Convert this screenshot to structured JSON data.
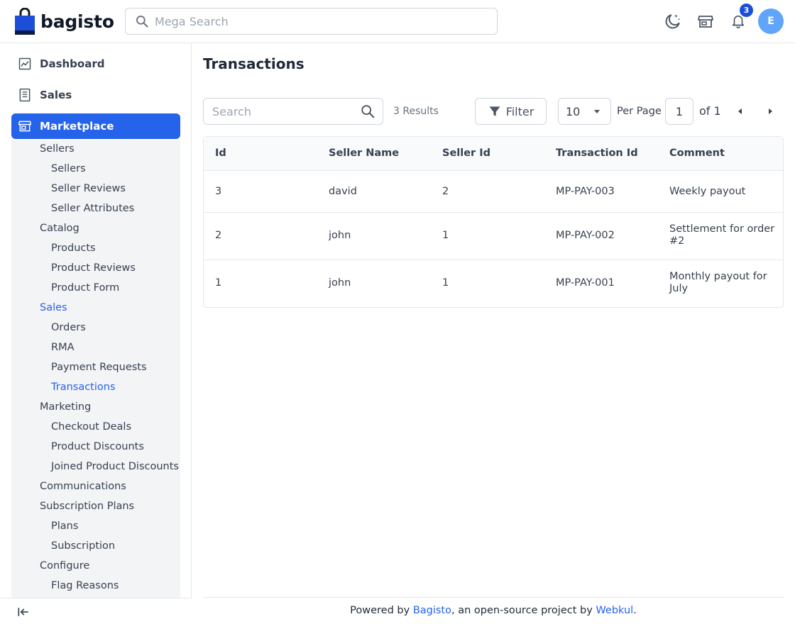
{
  "header": {
    "logo_text": "bagisto",
    "search_placeholder": "Mega Search",
    "notification_count": "3",
    "avatar_initial": "E"
  },
  "sidebar": {
    "top_items": [
      {
        "label": "Dashboard",
        "icon": "dashboard-icon"
      },
      {
        "label": "Sales",
        "icon": "sales-icon"
      },
      {
        "label": "Marketplace",
        "icon": "marketplace-icon",
        "active": true
      }
    ],
    "sub_items": [
      {
        "label": "Sellers",
        "level": 1
      },
      {
        "label": "Sellers",
        "level": 2
      },
      {
        "label": "Seller Reviews",
        "level": 2
      },
      {
        "label": "Seller Attributes",
        "level": 2
      },
      {
        "label": "Catalog",
        "level": 1
      },
      {
        "label": "Products",
        "level": 2
      },
      {
        "label": "Product Reviews",
        "level": 2
      },
      {
        "label": "Product Form",
        "level": 2
      },
      {
        "label": "Sales",
        "level": 1,
        "active": true
      },
      {
        "label": "Orders",
        "level": 2
      },
      {
        "label": "RMA",
        "level": 2
      },
      {
        "label": "Payment Requests",
        "level": 2
      },
      {
        "label": "Transactions",
        "level": 2,
        "active": true
      },
      {
        "label": "Marketing",
        "level": 1
      },
      {
        "label": "Checkout Deals",
        "level": 2
      },
      {
        "label": "Product Discounts",
        "level": 2
      },
      {
        "label": "Joined Product Discounts",
        "level": 2
      },
      {
        "label": "Communications",
        "level": 1
      },
      {
        "label": "Subscription Plans",
        "level": 1
      },
      {
        "label": "Plans",
        "level": 2
      },
      {
        "label": "Subscription",
        "level": 2
      },
      {
        "label": "Configure",
        "level": 1
      },
      {
        "label": "Flag Reasons",
        "level": 2
      }
    ]
  },
  "main": {
    "title": "Transactions",
    "search_placeholder": "Search",
    "results_text": "3 Results",
    "filter_label": "Filter",
    "per_page_value": "10",
    "per_page_label": "Per Page",
    "page_value": "1",
    "of_text": "of 1"
  },
  "table": {
    "columns": [
      "Id",
      "Seller Name",
      "Seller Id",
      "Transaction Id",
      "Comment"
    ],
    "rows": [
      [
        "3",
        "david",
        "2",
        "MP-PAY-003",
        "Weekly payout"
      ],
      [
        "2",
        "john",
        "1",
        "MP-PAY-002",
        "Settlement for order #2"
      ],
      [
        "1",
        "john",
        "1",
        "MP-PAY-001",
        "Monthly payout for July"
      ]
    ]
  },
  "footer": {
    "prefix": "Powered by ",
    "link1": "Bagisto",
    "middle": ", an open-source project by ",
    "link2": "Webkul",
    "suffix": "."
  },
  "colors": {
    "accent": "#2563eb",
    "avatar_bg": "#60a5fa",
    "badge_bg": "#1d4ed8",
    "submenu_bg": "#f3f4f6"
  }
}
